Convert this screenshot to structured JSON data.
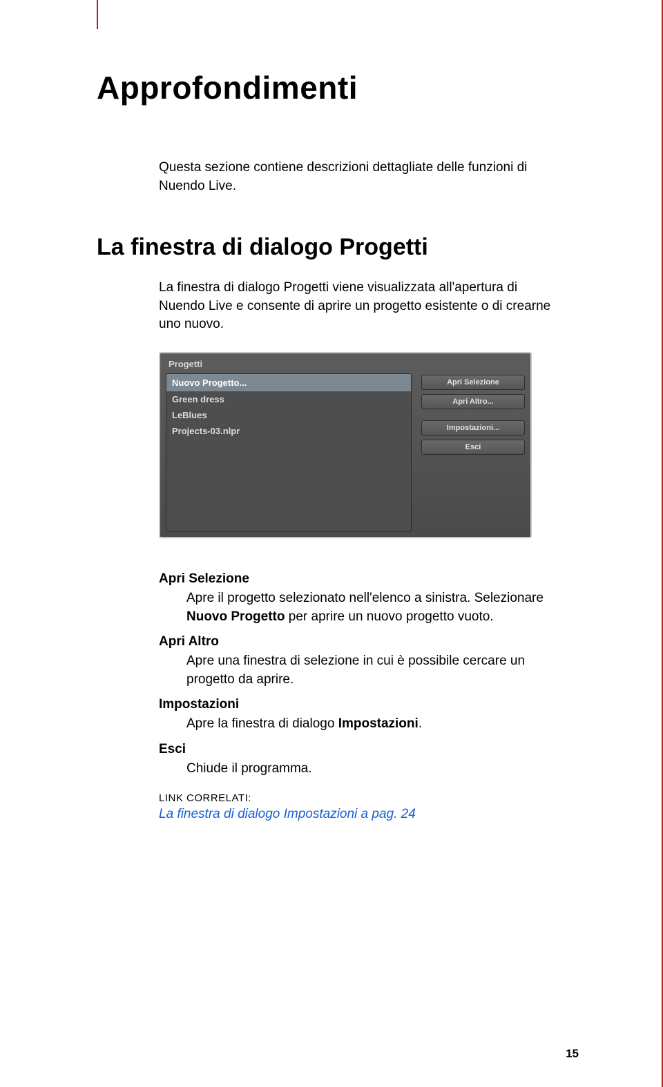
{
  "chapter_title": "Approfondimenti",
  "intro": "Questa sezione contiene descrizioni dettagliate delle funzioni di Nuendo Live.",
  "section": {
    "title": "La finestra di dialogo Progetti",
    "intro": "La finestra di dialogo Progetti viene visualizzata all'apertura di Nuendo Live e consente di aprire un progetto esistente o di crearne uno nuovo."
  },
  "dialog": {
    "title": "Progetti",
    "selected": "Nuovo Progetto...",
    "items": [
      "Green dress",
      "LeBlues",
      "Projects-03.nlpr"
    ],
    "buttons": {
      "open_selection": "Apri Selezione",
      "open_other": "Apri Altro...",
      "settings": "Impostazioni...",
      "exit": "Esci"
    }
  },
  "defs": {
    "apri_selezione": {
      "term": "Apri Selezione",
      "body_pre": "Apre il progetto selezionato nell'elenco a sinistra. Selezionare ",
      "body_bold": "Nuovo Progetto",
      "body_post": " per aprire un nuovo progetto vuoto."
    },
    "apri_altro": {
      "term": "Apri Altro",
      "body": "Apre una finestra di selezione in cui è possibile cercare un progetto da aprire."
    },
    "impostazioni": {
      "term": "Impostazioni",
      "body_pre": "Apre la finestra di dialogo ",
      "body_bold": "Impostazioni",
      "body_post": "."
    },
    "esci": {
      "term": "Esci",
      "body": "Chiude il programma."
    }
  },
  "links": {
    "label": "Link correlati:",
    "item": "La finestra di dialogo Impostazioni a pag. 24"
  },
  "page_number": "15"
}
